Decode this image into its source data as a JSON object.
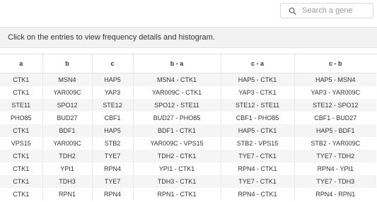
{
  "search": {
    "placeholder": "Search a gene",
    "value": ""
  },
  "info": {
    "text": "Click on the entries to view frequency details and histogram."
  },
  "table": {
    "headers": [
      "a",
      "b",
      "c",
      "b - a",
      "c - a",
      "c - b"
    ],
    "rows": [
      [
        "CTK1",
        "MSN4",
        "HAP5",
        "MSN4 - CTK1",
        "HAP5 - CTK1",
        "HAP5 - MSN4"
      ],
      [
        "CTK1",
        "YAR009C",
        "YAP3",
        "YAR009C - CTK1",
        "YAP3 - CTK1",
        "YAP3 - YAR009C"
      ],
      [
        "STE11",
        "SPO12",
        "STE12",
        "SPO12 - STE11",
        "STE12 - STE11",
        "STE12 - SPO12"
      ],
      [
        "PHO85",
        "BUD27",
        "CBF1",
        "BUD27 - PHO85",
        "CBF1 - PHO85",
        "CBF1 - BUD27"
      ],
      [
        "CTK1",
        "BDF1",
        "HAP5",
        "BDF1 - CTK1",
        "HAP5 - CTK1",
        "HAP5 - BDF1"
      ],
      [
        "VPS15",
        "YAR009C",
        "STB2",
        "YAR009C - VPS15",
        "STB2 - VPS15",
        "STB2 - YAR009C"
      ],
      [
        "CTK1",
        "TDH2",
        "TYE7",
        "TDH2 - CTK1",
        "TYE7 - CTK1",
        "TYE7 - TDH2"
      ],
      [
        "CTK1",
        "YPI1",
        "RPN4",
        "YPI1 - CTK1",
        "RPN4 - CTK1",
        "RPN4 - YPI1"
      ],
      [
        "CTK1",
        "TDH3",
        "TYE7",
        "TDH3 - CTK1",
        "TYE7 - CTK1",
        "TYE7 - TDH3"
      ],
      [
        "CTK1",
        "RPN1",
        "RPN4",
        "RPN1 - CTK1",
        "RPN4 - CTK1",
        "RPN4 - RPN1"
      ]
    ]
  }
}
